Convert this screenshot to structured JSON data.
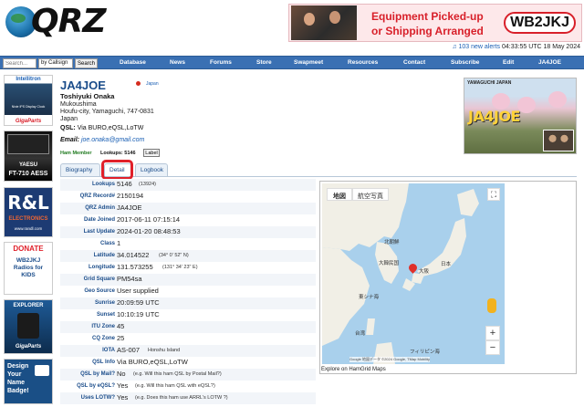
{
  "header": {
    "logo_text": "QRZ",
    "ad": {
      "line1": "Equipment Picked-up",
      "line2": "or Shipping Arranged",
      "brand": "WB2JKJ"
    }
  },
  "topline": {
    "alerts_link": "103 new alerts",
    "time": "04:33:55 UTC 18 May 2024"
  },
  "search": {
    "placeholder": "Search...",
    "by_option": "by Callsign",
    "button": "Search"
  },
  "nav": [
    "Database",
    "News",
    "Forums",
    "Store",
    "Swapmeet",
    "Resources",
    "Contact",
    "Subscribe",
    "Edit",
    "JA4JOE"
  ],
  "left_ads": [
    {
      "title": "Intellitron",
      "subtitle": "Nixie IPS Display Clock",
      "brand": "GigaParts"
    },
    {
      "title": "YAESU",
      "subtitle": "FT-710 AESS",
      "brand": ""
    },
    {
      "title": "R&L",
      "subtitle": "ELECTRONICS",
      "brand": "www.randl.com"
    },
    {
      "title": "DONATE",
      "subtitle": "WB2JKJ Radios for KIDS",
      "brand": ""
    },
    {
      "title": "EXPLORER",
      "subtitle": "",
      "brand": "GigaParts"
    },
    {
      "title": "Design Your Name Badge!",
      "subtitle": "",
      "brand": ""
    }
  ],
  "profile": {
    "callsign": "JA4JOE",
    "country_small": "Japan",
    "name": "Toshiyuki Onaka",
    "address": [
      "Mukoushima",
      "Houfu-city, Yamaguchi, 747-0831",
      "Japan"
    ],
    "qsl_label": "QSL:",
    "qsl_value": "Via BURO,eQSL,LoTW",
    "email_label": "Email:",
    "email": "joe.onaka@gmail.com",
    "ham_member": "Ham Member",
    "lookups_top": "Lookups: 5146",
    "label_button": "Label",
    "image_header": "YAMAGUCHI JAPAN",
    "image_callsign": "JA4JOE"
  },
  "tabs": [
    "Biography",
    "Detail",
    "Logbook"
  ],
  "details": [
    {
      "key": "Lookups",
      "value": "5146",
      "note": "(13924)"
    },
    {
      "key": "QRZ Record#",
      "value": "2150194",
      "note": ""
    },
    {
      "key": "QRZ Admin",
      "value": "JA4JOE",
      "note": ""
    },
    {
      "key": "Date Joined",
      "value": "2017-06-11 07:15:14",
      "note": ""
    },
    {
      "key": "Last Update",
      "value": "2024-01-20 08:48:53",
      "note": ""
    },
    {
      "key": "Class",
      "value": "1",
      "note": ""
    },
    {
      "key": "Latitude",
      "value": "34.014522",
      "note": "(34° 0' 52\" N)"
    },
    {
      "key": "Longitude",
      "value": "131.573255",
      "note": "(131° 34' 23\" E)"
    },
    {
      "key": "Grid Square",
      "value": "PM54sa",
      "note": ""
    },
    {
      "key": "Geo Source",
      "value": "User supplied",
      "note": ""
    },
    {
      "key": "Sunrise",
      "value": "20:09:59 UTC",
      "note": ""
    },
    {
      "key": "Sunset",
      "value": "10:10:19 UTC",
      "note": ""
    },
    {
      "key": "ITU Zone",
      "value": "45",
      "note": ""
    },
    {
      "key": "CQ Zone",
      "value": "25",
      "note": ""
    },
    {
      "key": "IOTA",
      "value": "AS-007",
      "note": "Honshu Island"
    },
    {
      "key": "QSL Info",
      "value": "Via BURO,eQSL,LoTW",
      "note": ""
    },
    {
      "key": "QSL by Mail?",
      "value": "No",
      "note": "(e.g. Will this ham QSL by Postal Mail?)"
    },
    {
      "key": "QSL by eQSL?",
      "value": "Yes",
      "note": "(e.g. Will this ham QSL with eQSL?)"
    },
    {
      "key": "Uses LOTW?",
      "value": "Yes",
      "note": "(e.g. Does this ham use ARRL's LOTW ?)"
    }
  ],
  "map": {
    "btn_map": "地図",
    "btn_satellite": "航空写真",
    "labels": [
      "北朝鮮",
      "大韓民国",
      "日本",
      "大阪",
      "東シナ海",
      "台湾",
      "フィリピン海"
    ],
    "attribution": "Google  地図データ ©2024 Google, TMap Mobility",
    "caption": "Explore on HamGrid Maps"
  }
}
